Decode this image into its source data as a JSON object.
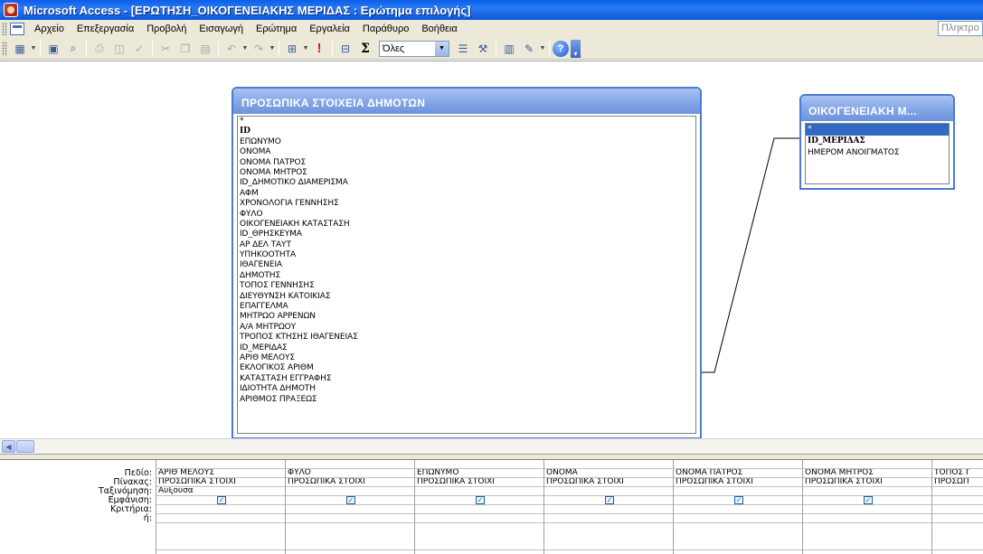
{
  "window": {
    "title": "Microsoft Access - [ΕΡΩΤΗΣΗ_ΟΙΚΟΓΕΝΕΙΑΚΗΣ ΜΕΡΙΔΑΣ : Ερώτημα επιλογής]"
  },
  "menu": {
    "items": [
      "Αρχείο",
      "Επεξεργασία",
      "Προβολή",
      "Εισαγωγή",
      "Ερώτημα",
      "Εργαλεία",
      "Παράθυρο",
      "Βοήθεια"
    ],
    "help_placeholder": "Πληκτρο"
  },
  "toolbar": {
    "top_values_label": "Όλες",
    "icons": [
      "view-icon",
      "save-icon",
      "search-icon",
      "print-icon",
      "print-preview-icon",
      "spelling-icon",
      "cut-icon",
      "copy-icon",
      "paste-icon",
      "undo-icon",
      "redo-icon",
      "query-type-icon",
      "run-icon",
      "show-table-icon",
      "totals-icon",
      "properties-icon",
      "builder-icon",
      "database-window-icon",
      "new-object-icon",
      "help-icon"
    ]
  },
  "tables": [
    {
      "title": "ΠΡΟΣΩΠΙΚΑ ΣΤΟΙΧΕΙΑ ΔΗΜΟΤΩΝ",
      "fields": [
        "*",
        "ID",
        "ΕΠΩΝΥΜΟ",
        "ΟΝΟΜΑ",
        "ΟΝΟΜΑ ΠΑΤΡΟΣ",
        "ΟΝΟΜΑ ΜΗΤΡΟΣ",
        "ID_ΔΗΜΟΤΙΚΟ ΔΙΑΜΕΡΙΣΜΑ",
        "ΑΦΜ",
        "ΧΡΟΝΟΛΟΓΙΑ ΓΕΝΝΗΣΗΣ",
        "ΦΥΛΟ",
        "ΟΙΚΟΓΕΝΕΙΑΚΗ ΚΑΤΑΣΤΑΣΗ",
        "ID_ΘΡΗΣΚΕΥΜΑ",
        "ΑΡ ΔΕΛ ΤΑΥΤ",
        "ΥΠΗΚΟΟΤΗΤΑ",
        "ΙΘΑΓΕΝΕΙΑ",
        "ΔΗΜΟΤΗΣ",
        "ΤΟΠΟΣ ΓΕΝΝΗΣΗΣ",
        "ΔΙΕΥΘΥΝΣΗ ΚΑΤΟΙΚΙΑΣ",
        "ΕΠΑΓΓΕΛΜΑ",
        "ΜΗΤΡΩΟ ΑΡΡΕΝΩΝ",
        "Α/Α ΜΗΤΡΩΟΥ",
        "ΤΡΟΠΟΣ ΚΤΗΣΗΣ ΙΘΑΓΕΝΕΙΑΣ",
        "ID_ΜΕΡΙΔΑΣ",
        "ΑΡΙΘ ΜΕΛΟΥΣ",
        "ΕΚΛΟΓΙΚΟΣ ΑΡΙΘΜ",
        "ΚΑΤΑΣΤΑΣΗ ΕΓΓΡΑΦΗΣ",
        "ΙΔΙΟΤΗΤΑ ΔΗΜΟΤΗ",
        "ΑΡΙΘΜΟΣ ΠΡΑΞΕΩΣ"
      ],
      "key_fields": [
        "ID"
      ]
    },
    {
      "title": "ΟΙΚΟΓΕΝΕΙΑΚΗ Μ...",
      "fields": [
        "*",
        "ID_ΜΕΡΙΔΑΣ",
        "ΗΜΕΡΟΜ ΑΝΟΙΓΜΑΤΟΣ"
      ],
      "key_fields": [
        "ID_ΜΕΡΙΔΑΣ"
      ],
      "selected_field": "*"
    }
  ],
  "grid": {
    "row_labels": [
      "Πεδίο:",
      "Πίνακας:",
      "Ταξινόμηση:",
      "Εμφάνιση:",
      "Κριτήρια:",
      "ή:"
    ],
    "columns": [
      {
        "field": "ΑΡΙΘ ΜΕΛΟΥΣ",
        "table": "ΠΡΟΣΩΠΙΚΑ ΣΤΟΙΧΙ",
        "sort": "Αύξουσα",
        "show": true
      },
      {
        "field": "ΦΥΛΟ",
        "table": "ΠΡΟΣΩΠΙΚΑ ΣΤΟΙΧΙ",
        "sort": "",
        "show": true
      },
      {
        "field": "ΕΠΩΝΥΜΟ",
        "table": "ΠΡΟΣΩΠΙΚΑ ΣΤΟΙΧΙ",
        "sort": "",
        "show": true
      },
      {
        "field": "ΟΝΟΜΑ",
        "table": "ΠΡΟΣΩΠΙΚΑ ΣΤΟΙΧΙ",
        "sort": "",
        "show": true
      },
      {
        "field": "ΟΝΟΜΑ ΠΑΤΡΟΣ",
        "table": "ΠΡΟΣΩΠΙΚΑ ΣΤΟΙΧΙ",
        "sort": "",
        "show": true
      },
      {
        "field": "ΟΝΟΜΑ ΜΗΤΡΟΣ",
        "table": "ΠΡΟΣΩΠΙΚΑ ΣΤΟΙΧΙ",
        "sort": "",
        "show": true
      },
      {
        "field": "ΤΟΠΟΣ Γ",
        "table": "ΠΡΟΣΩΠ",
        "sort": "",
        "show": false
      }
    ]
  },
  "colors": {
    "titlebar": "#0a5ee8",
    "field_list_header": "#7fa3e6",
    "selection": "#316ac5",
    "chrome": "#ece9d8"
  }
}
